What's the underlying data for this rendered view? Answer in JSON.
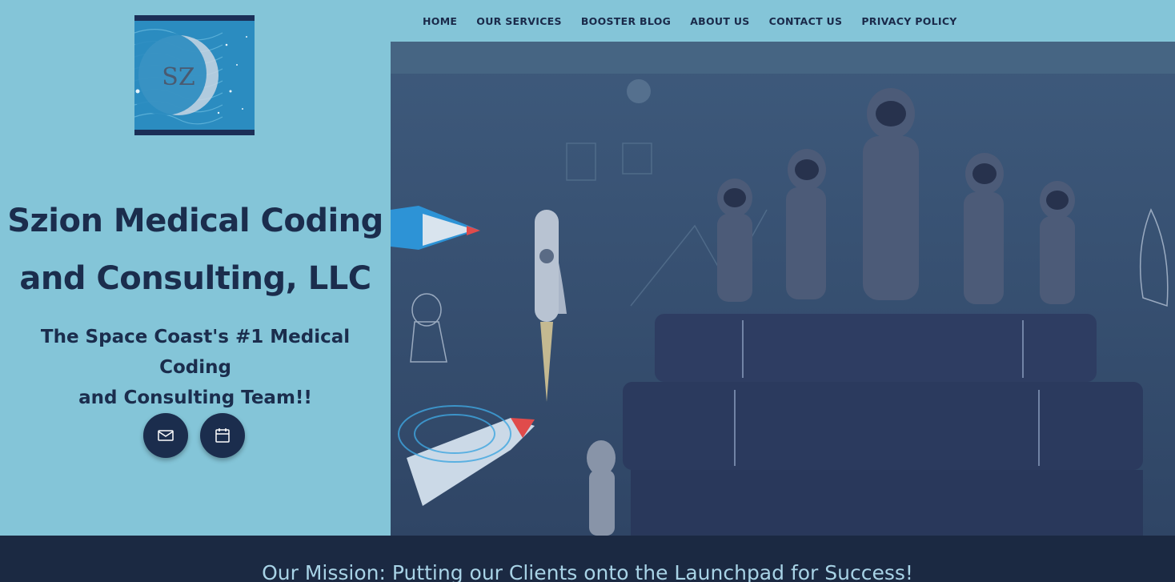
{
  "nav": {
    "items": [
      "HOME",
      "OUR SERVICES",
      "BOOSTER BLOG",
      "ABOUT US",
      "CONTACT US",
      "PRIVACY POLICY"
    ]
  },
  "logo": {
    "text": "SZ"
  },
  "hero": {
    "title_line1": "Szion Medical Coding",
    "title_line2": "and Consulting, LLC",
    "subtitle_line1": "The Space Coast's #1 Medical Coding",
    "subtitle_line2": "and Consulting Team!!"
  },
  "icons": {
    "email": "email-icon",
    "calendar": "calendar-icon"
  },
  "mission": {
    "text": "Our Mission: Putting our Clients onto the Launchpad for Success!"
  },
  "colors": {
    "background": "#84c5d8",
    "dark_navy": "#1b2d4d",
    "footer": "#1b2942",
    "mission_text": "#a8d3e6"
  }
}
